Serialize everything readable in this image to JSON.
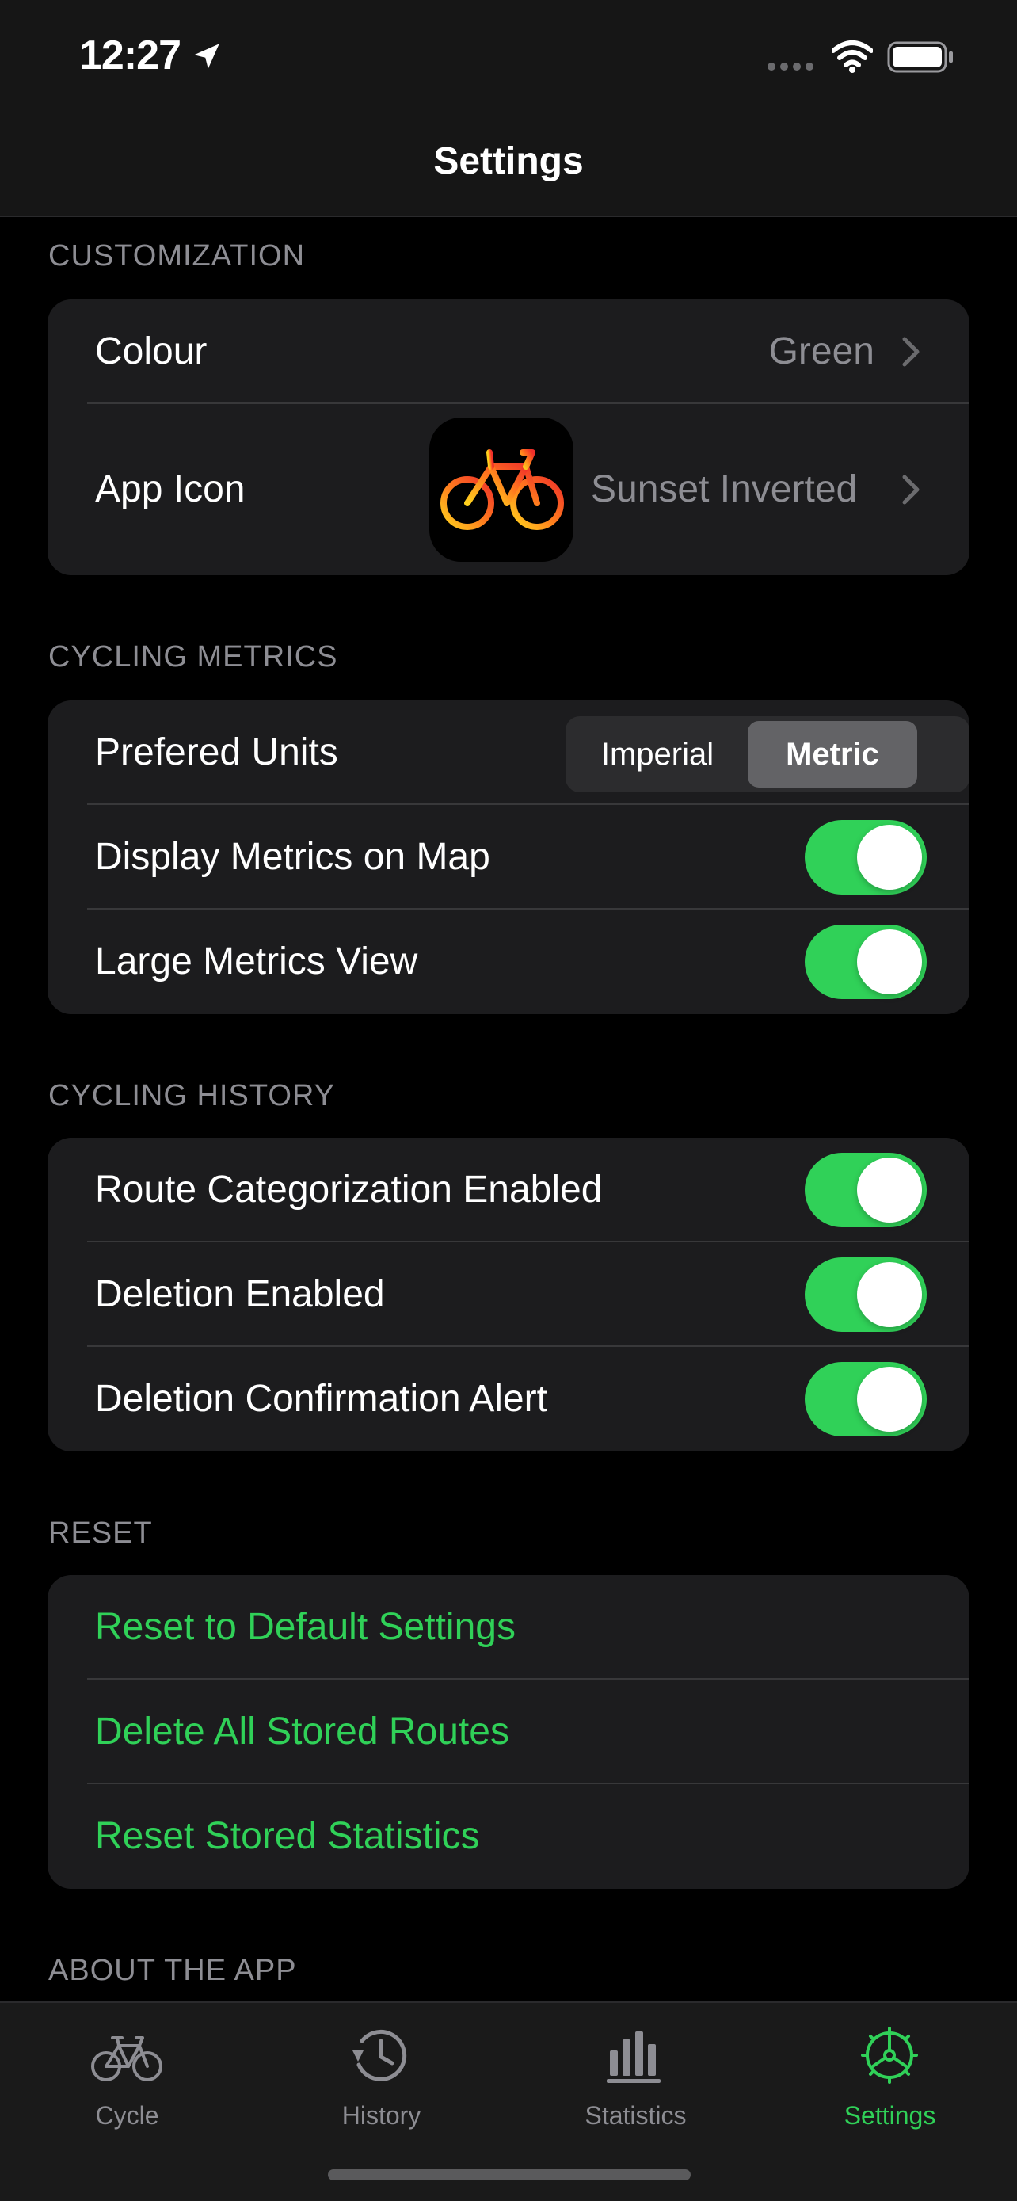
{
  "status_bar": {
    "time": "12:27",
    "icons": [
      "location-arrow-icon",
      "signal-icon",
      "wifi-icon",
      "battery-icon"
    ]
  },
  "nav": {
    "title": "Settings"
  },
  "customization": {
    "header": "CUSTOMIZATION",
    "colour_label": "Colour",
    "colour_value": "Green",
    "app_icon_label": "App Icon",
    "app_icon_value": "Sunset Inverted"
  },
  "metrics": {
    "header": "CYCLING METRICS",
    "units_label": "Prefered Units",
    "units_options": [
      "Imperial",
      "Metric"
    ],
    "units_selected": "Metric",
    "display_map_label": "Display Metrics on Map",
    "display_map_on": true,
    "large_view_label": "Large Metrics View",
    "large_view_on": true
  },
  "history": {
    "header": "CYCLING HISTORY",
    "route_cat_label": "Route Categorization Enabled",
    "route_cat_on": true,
    "deletion_label": "Deletion Enabled",
    "deletion_on": true,
    "deletion_alert_label": "Deletion Confirmation Alert",
    "deletion_alert_on": true
  },
  "reset": {
    "header": "RESET",
    "reset_defaults": "Reset to Default Settings",
    "delete_routes": "Delete All Stored Routes",
    "reset_stats": "Reset Stored Statistics"
  },
  "about": {
    "header": "ABOUT THE APP"
  },
  "tabs": [
    {
      "label": "Cycle",
      "icon": "bicycle-icon",
      "active": false
    },
    {
      "label": "History",
      "icon": "history-clock-icon",
      "active": false
    },
    {
      "label": "Statistics",
      "icon": "bar-chart-icon",
      "active": false
    },
    {
      "label": "Settings",
      "icon": "gear-icon",
      "active": true
    }
  ],
  "colors": {
    "accent": "#30d158",
    "background": "#000000",
    "group": "#1c1c1e",
    "secondary_text": "#8d8d93"
  }
}
